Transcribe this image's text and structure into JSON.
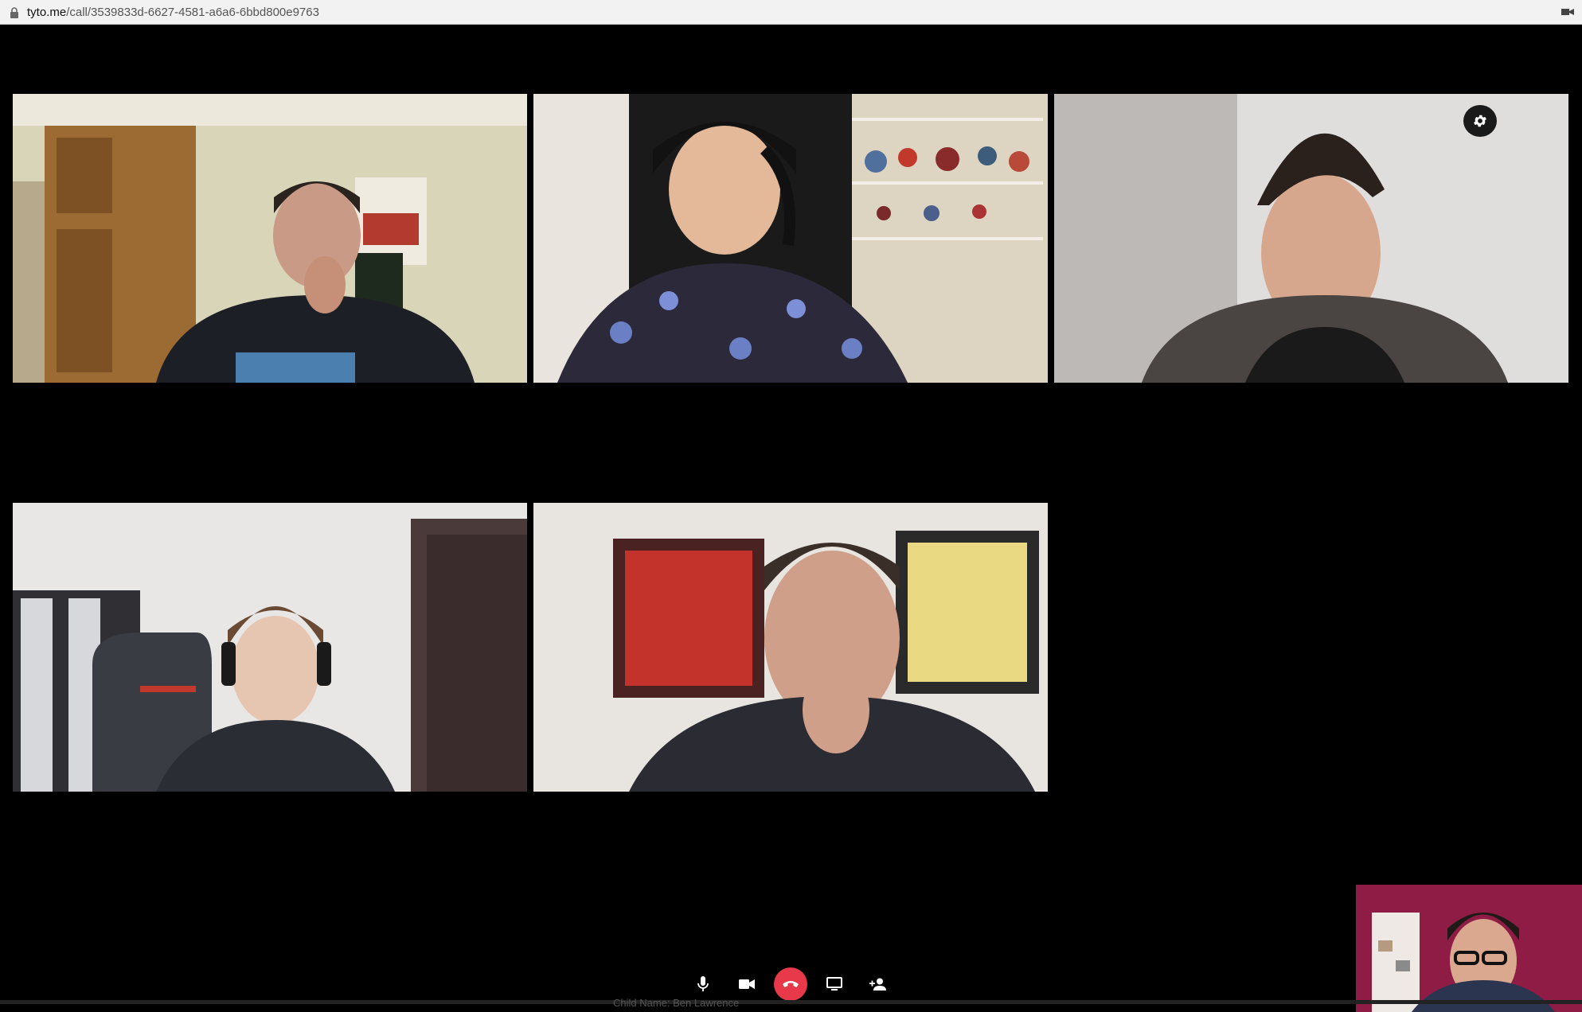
{
  "browser": {
    "url_host": "tyto.me",
    "url_path": "/call/3539833d-6627-4581-a6a6-6bbd800e9763"
  },
  "colors": {
    "background": "#000000",
    "hangup": "#e8394a",
    "control_icon": "#ffffff"
  },
  "participants": [
    {
      "id": "p1",
      "tile_label": "participant-video-1"
    },
    {
      "id": "p2",
      "tile_label": "participant-video-2"
    },
    {
      "id": "p3",
      "tile_label": "participant-video-3"
    },
    {
      "id": "p4",
      "tile_label": "participant-video-4"
    },
    {
      "id": "p5",
      "tile_label": "participant-video-5"
    }
  ],
  "controls": [
    {
      "name": "microphone",
      "icon": "mic-icon"
    },
    {
      "name": "camera",
      "icon": "video-camera-icon"
    },
    {
      "name": "hang-up",
      "icon": "phone-hangup-icon"
    },
    {
      "name": "share-screen",
      "icon": "monitor-icon"
    },
    {
      "name": "add-participant",
      "icon": "person-add-icon"
    }
  ],
  "footer": {
    "caption": "Child Name: Ben Lawrence"
  }
}
